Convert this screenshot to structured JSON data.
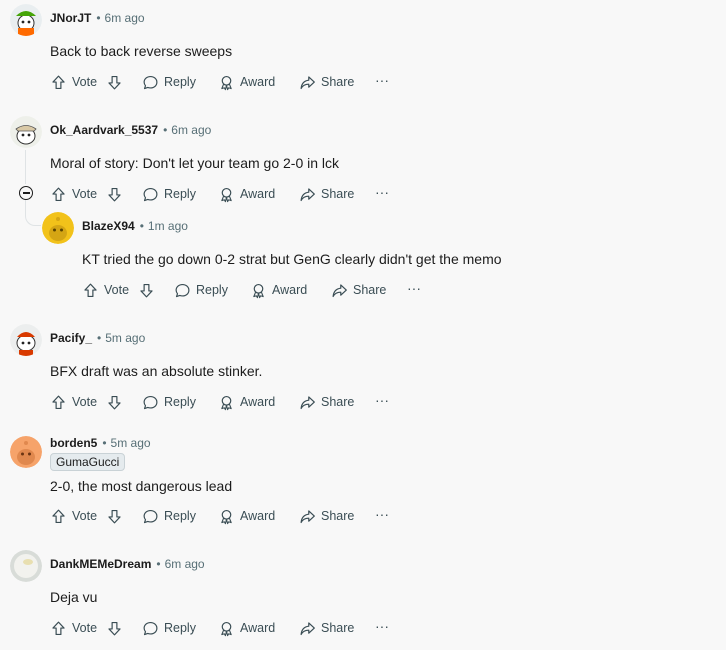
{
  "actions": {
    "vote": "Vote",
    "reply": "Reply",
    "award": "Award",
    "share": "Share",
    "more": "···"
  },
  "separator": "•",
  "comments": [
    {
      "author": "JNorJT",
      "time": "6m ago",
      "body": "Back to back reverse sweeps",
      "avatar": "snoo-green-cap-avatar"
    },
    {
      "author": "Ok_Aardvark_5537",
      "time": "6m ago",
      "body": "Moral of story: Don't let your team go 2-0 in lck",
      "avatar": "snoo-bandana-avatar"
    },
    {
      "author": "BlazeX94",
      "time": "1m ago",
      "body": "KT tried the go down 0-2 strat but GenG clearly didn't get the memo",
      "avatar": "snoo-yellow-avatar"
    },
    {
      "author": "Pacify_",
      "time": "5m ago",
      "body": "BFX draft was an absolute stinker.",
      "avatar": "snoo-red-avatar"
    },
    {
      "author": "borden5",
      "time": "5m ago",
      "flair": "GumaGucci",
      "body": "2-0, the most dangerous lead",
      "avatar": "snoo-orange-avatar"
    },
    {
      "author": "DankMEMeDream",
      "time": "6m ago",
      "body": "Deja vu",
      "avatar": "egg-avatar"
    }
  ],
  "colors": {
    "background": "#f8f8f8",
    "text": "#1c1c1c",
    "muted": "#576f76",
    "action": "#3a4d54"
  }
}
